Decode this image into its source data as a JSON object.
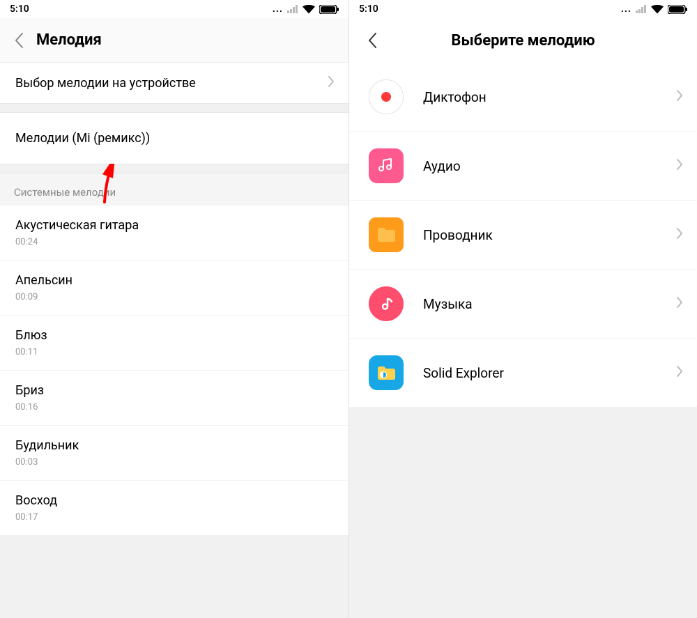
{
  "status": {
    "time": "5:10",
    "dots": "..."
  },
  "left": {
    "title": "Мелодия",
    "deviceRow": "Выбор мелодии на устройстве",
    "remixRow": "Мелодии (Mi (ремикс))",
    "sectionTitle": "Системные мелодии",
    "items": [
      {
        "name": "Акустическая гитара",
        "dur": "00:24"
      },
      {
        "name": "Апельсин",
        "dur": "00:09"
      },
      {
        "name": "Блюз",
        "dur": "00:11"
      },
      {
        "name": "Бриз",
        "dur": "00:16"
      },
      {
        "name": "Будильник",
        "dur": "00:03"
      },
      {
        "name": "Восход",
        "dur": "00:17"
      }
    ]
  },
  "right": {
    "title": "Выберите мелодию",
    "apps": [
      {
        "name": "Диктофон",
        "icon": "recorder"
      },
      {
        "name": "Аудио",
        "icon": "audio"
      },
      {
        "name": "Проводник",
        "icon": "explorer"
      },
      {
        "name": "Музыка",
        "icon": "music"
      },
      {
        "name": "Solid Explorer",
        "icon": "solid"
      }
    ]
  }
}
